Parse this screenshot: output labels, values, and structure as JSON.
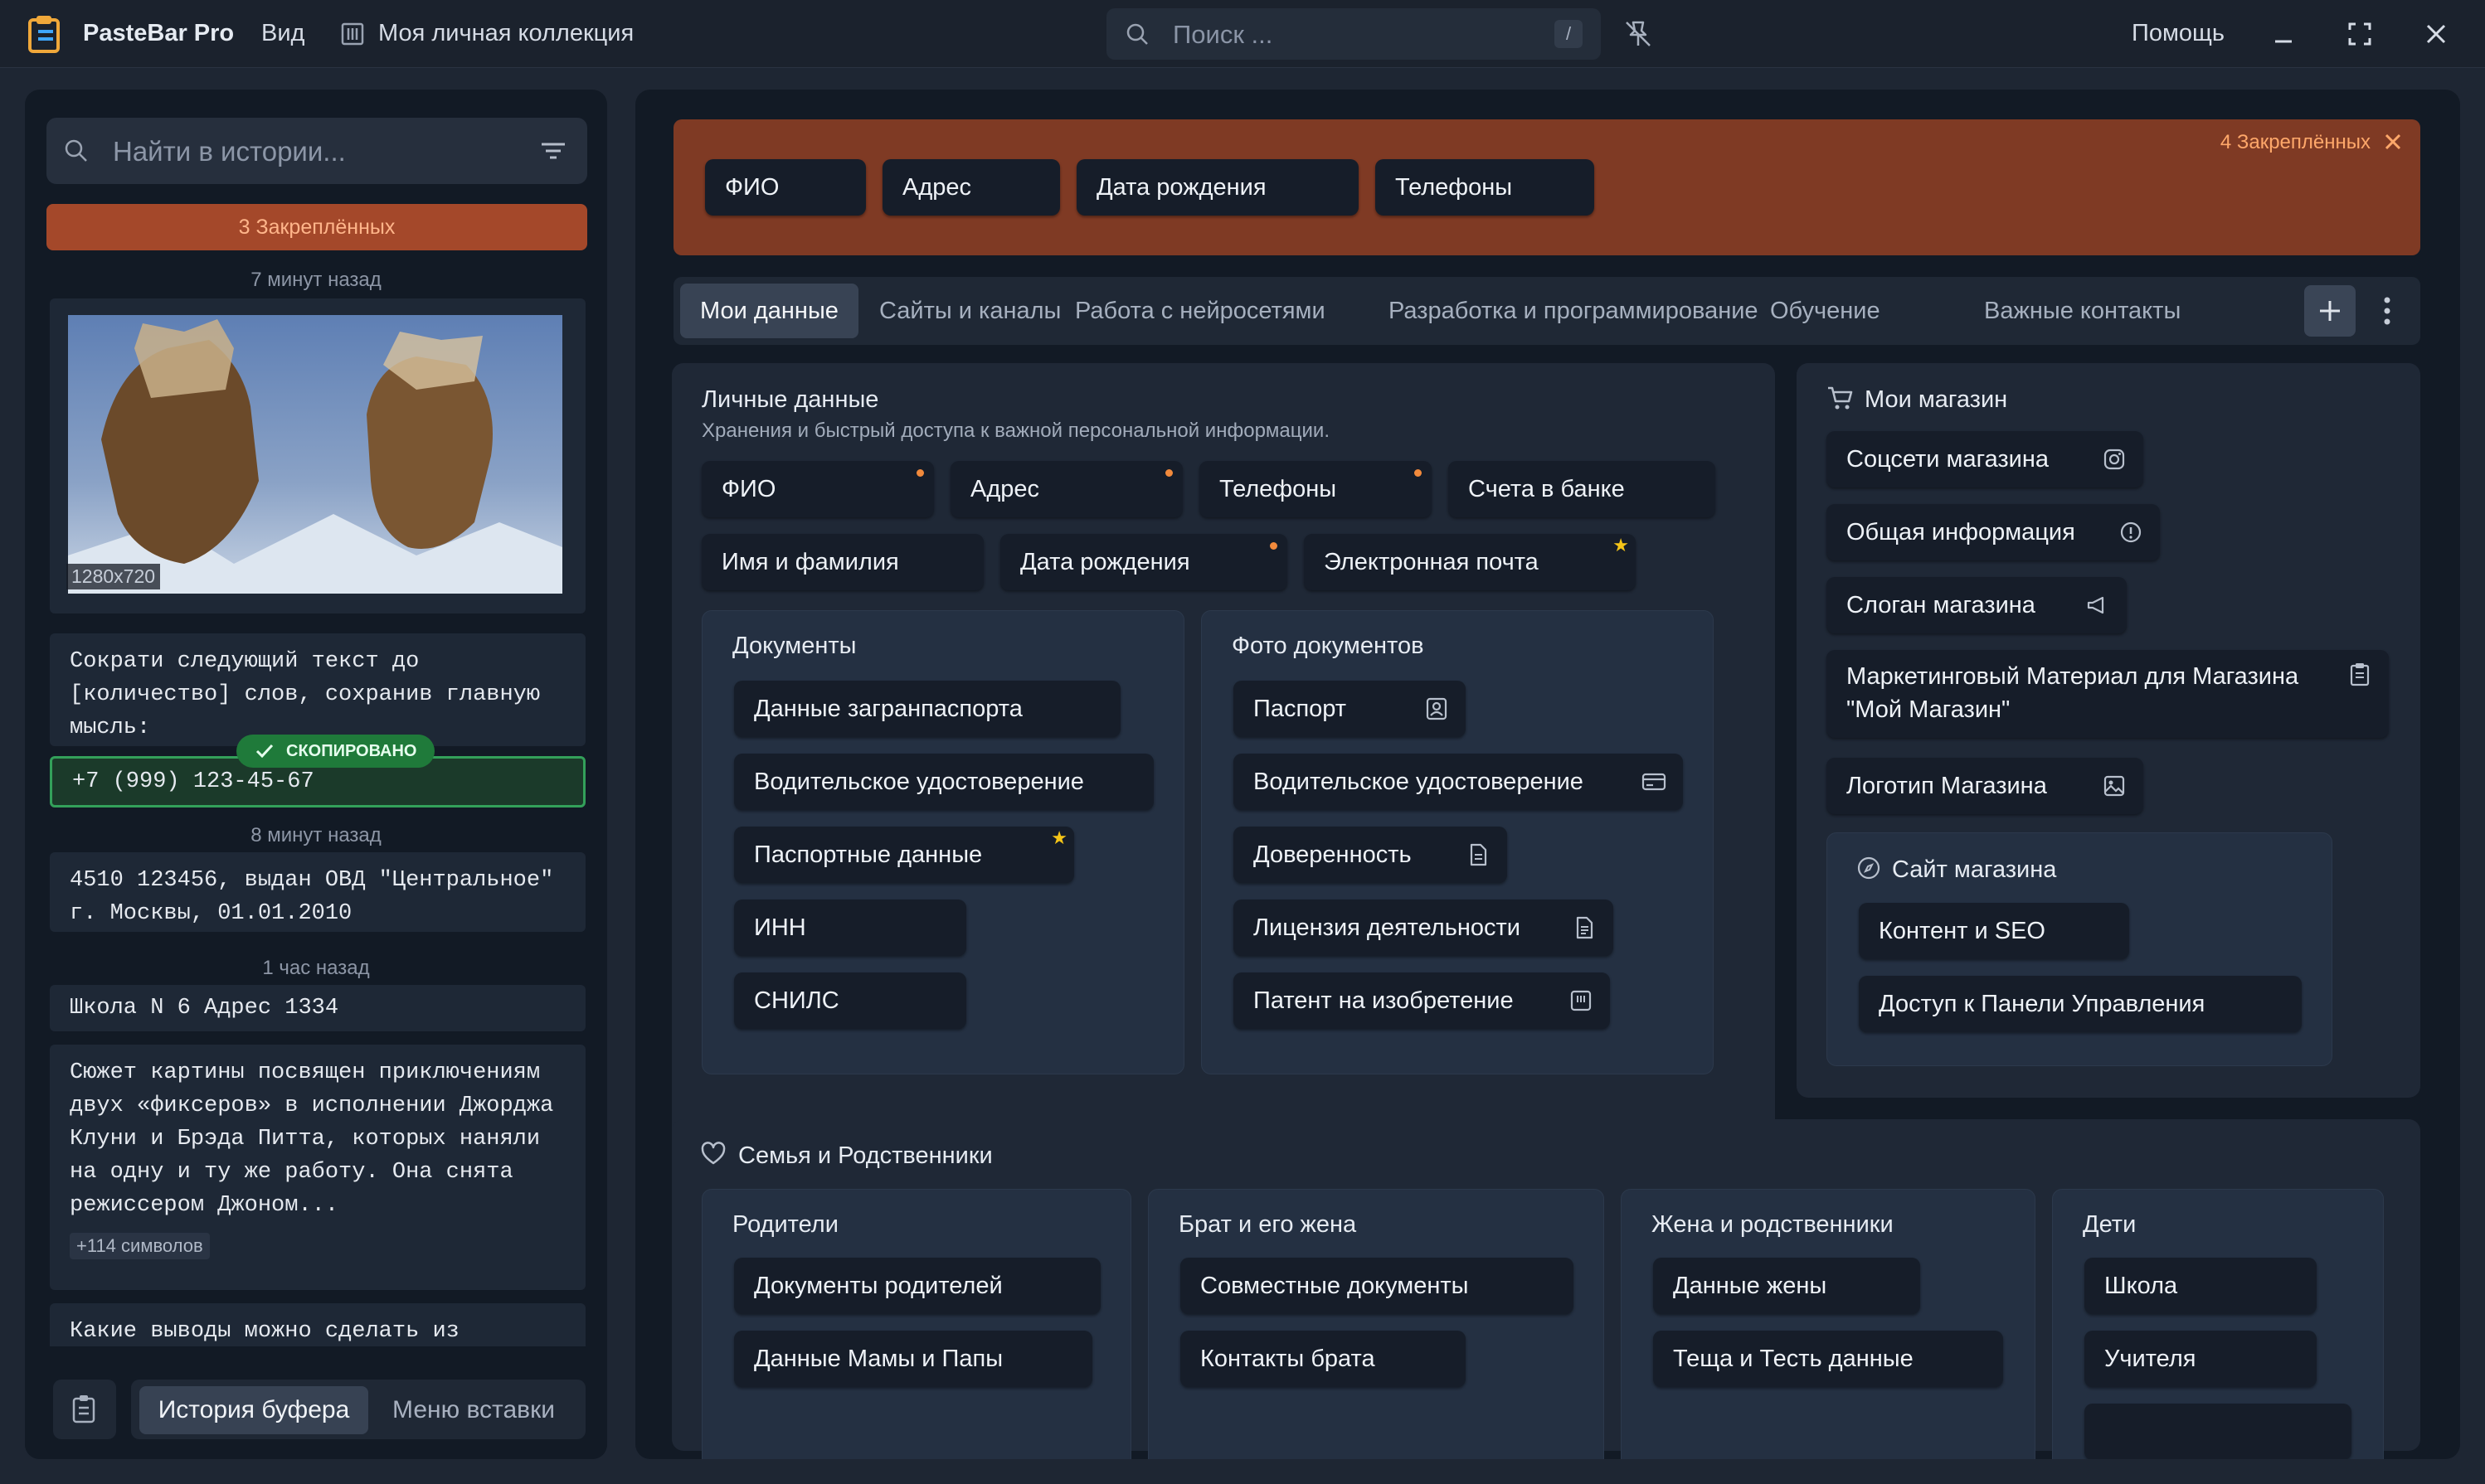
{
  "titlebar": {
    "app_name": "PasteBar Pro",
    "view_menu": "Вид",
    "collection": "Моя личная коллекция",
    "search_placeholder": "Поиск ...",
    "search_shortcut": "/",
    "help": "Помощь"
  },
  "history": {
    "search_placeholder": "Найти в истории...",
    "pinned_label": "3 Закреплённых",
    "items": [
      {
        "time": "7 минут назад",
        "type": "image",
        "dimensions": "1280x720"
      },
      {
        "type": "text",
        "text": "Сократи следующий текст до [количество] слов, сохранив главную мысль:"
      },
      {
        "type": "text",
        "text": "+7 (999) 123-45-67",
        "badge": "СКОПИРОВАНО"
      },
      {
        "time": "8 минут назад",
        "type": "text",
        "text": "4510 123456, выдан ОВД \"Центральное\" г. Москвы, 01.01.2010"
      },
      {
        "time": "1 час назад",
        "type": "text",
        "text": "Школа N 6 Адрес 1334"
      },
      {
        "type": "text",
        "text": "Сюжет картины посвящен приключениям двух «фиксеров» в исполнении Джорджа Клуни и Брэда Питта, которых наняли на одну и ту же работу. Она снята режиссером Джоном...",
        "more": "+114 символов"
      },
      {
        "type": "text",
        "text": "Какие выводы можно сделать из следующих данных"
      }
    ],
    "tabs": [
      "История буфера",
      "Меню вставки"
    ]
  },
  "pinned_bar": {
    "label": "4 Закреплённых",
    "chips": [
      "ФИО",
      "Адрес",
      "Дата рождения",
      "Телефоны"
    ]
  },
  "tabs": [
    "Мои данные",
    "Сайты и каналы",
    "Работа с нейросетями",
    "Разработка и программирование",
    "Обучение",
    "Важные контакты"
  ],
  "personal": {
    "title": "Личные данные",
    "subtitle": "Хранения и быстрый доступа к важной персональной информации.",
    "clips": [
      "ФИО",
      "Адрес",
      "Телефоны",
      "Счета в банке",
      "Имя и фамилия",
      "Дата рождения",
      "Электронная  почта"
    ],
    "docs": {
      "title": "Документы",
      "clips": [
        "Данные загранпаспорта",
        "Водительское удостоверение",
        "Паспортные данные",
        "ИНН",
        "СНИЛС"
      ]
    },
    "photos": {
      "title": "Фото документов",
      "clips": [
        "Паспорт",
        "Водительское удостоверение",
        "Доверенность",
        "Лицензия деятельности",
        "Патент на изобретение"
      ]
    }
  },
  "shop": {
    "title": "Мои магазин",
    "clips": [
      "Соцсети магазина",
      "Общая информация",
      "Слоган магазина",
      "Маркетинговый Материал для Магазина \"Мой Магазин\"",
      "Логотип Магазина"
    ],
    "site": {
      "title": "Сайт магазина",
      "clips": [
        "Контент и SEO",
        "Доступ к Панели Управления"
      ]
    }
  },
  "family": {
    "title": "Семья и Родственники",
    "parents": {
      "title": "Родители",
      "clips": [
        "Документы родителей",
        "Данные Мамы и Папы"
      ]
    },
    "brother": {
      "title": "Брат и его жена",
      "clips": [
        "Совместные документы",
        "Контакты брата"
      ]
    },
    "wife": {
      "title": "Жена и родственники",
      "clips": [
        "Данные жены",
        "Теща и Тесть данные"
      ]
    },
    "kids": {
      "title": "Дети",
      "clips": [
        "Школа",
        "Учителя"
      ]
    }
  },
  "colors": {
    "accent_orange": "#f28a3c",
    "pinned_bg": "#7f3a24",
    "copied_green": "#33a05a",
    "star": "#f5c518"
  }
}
